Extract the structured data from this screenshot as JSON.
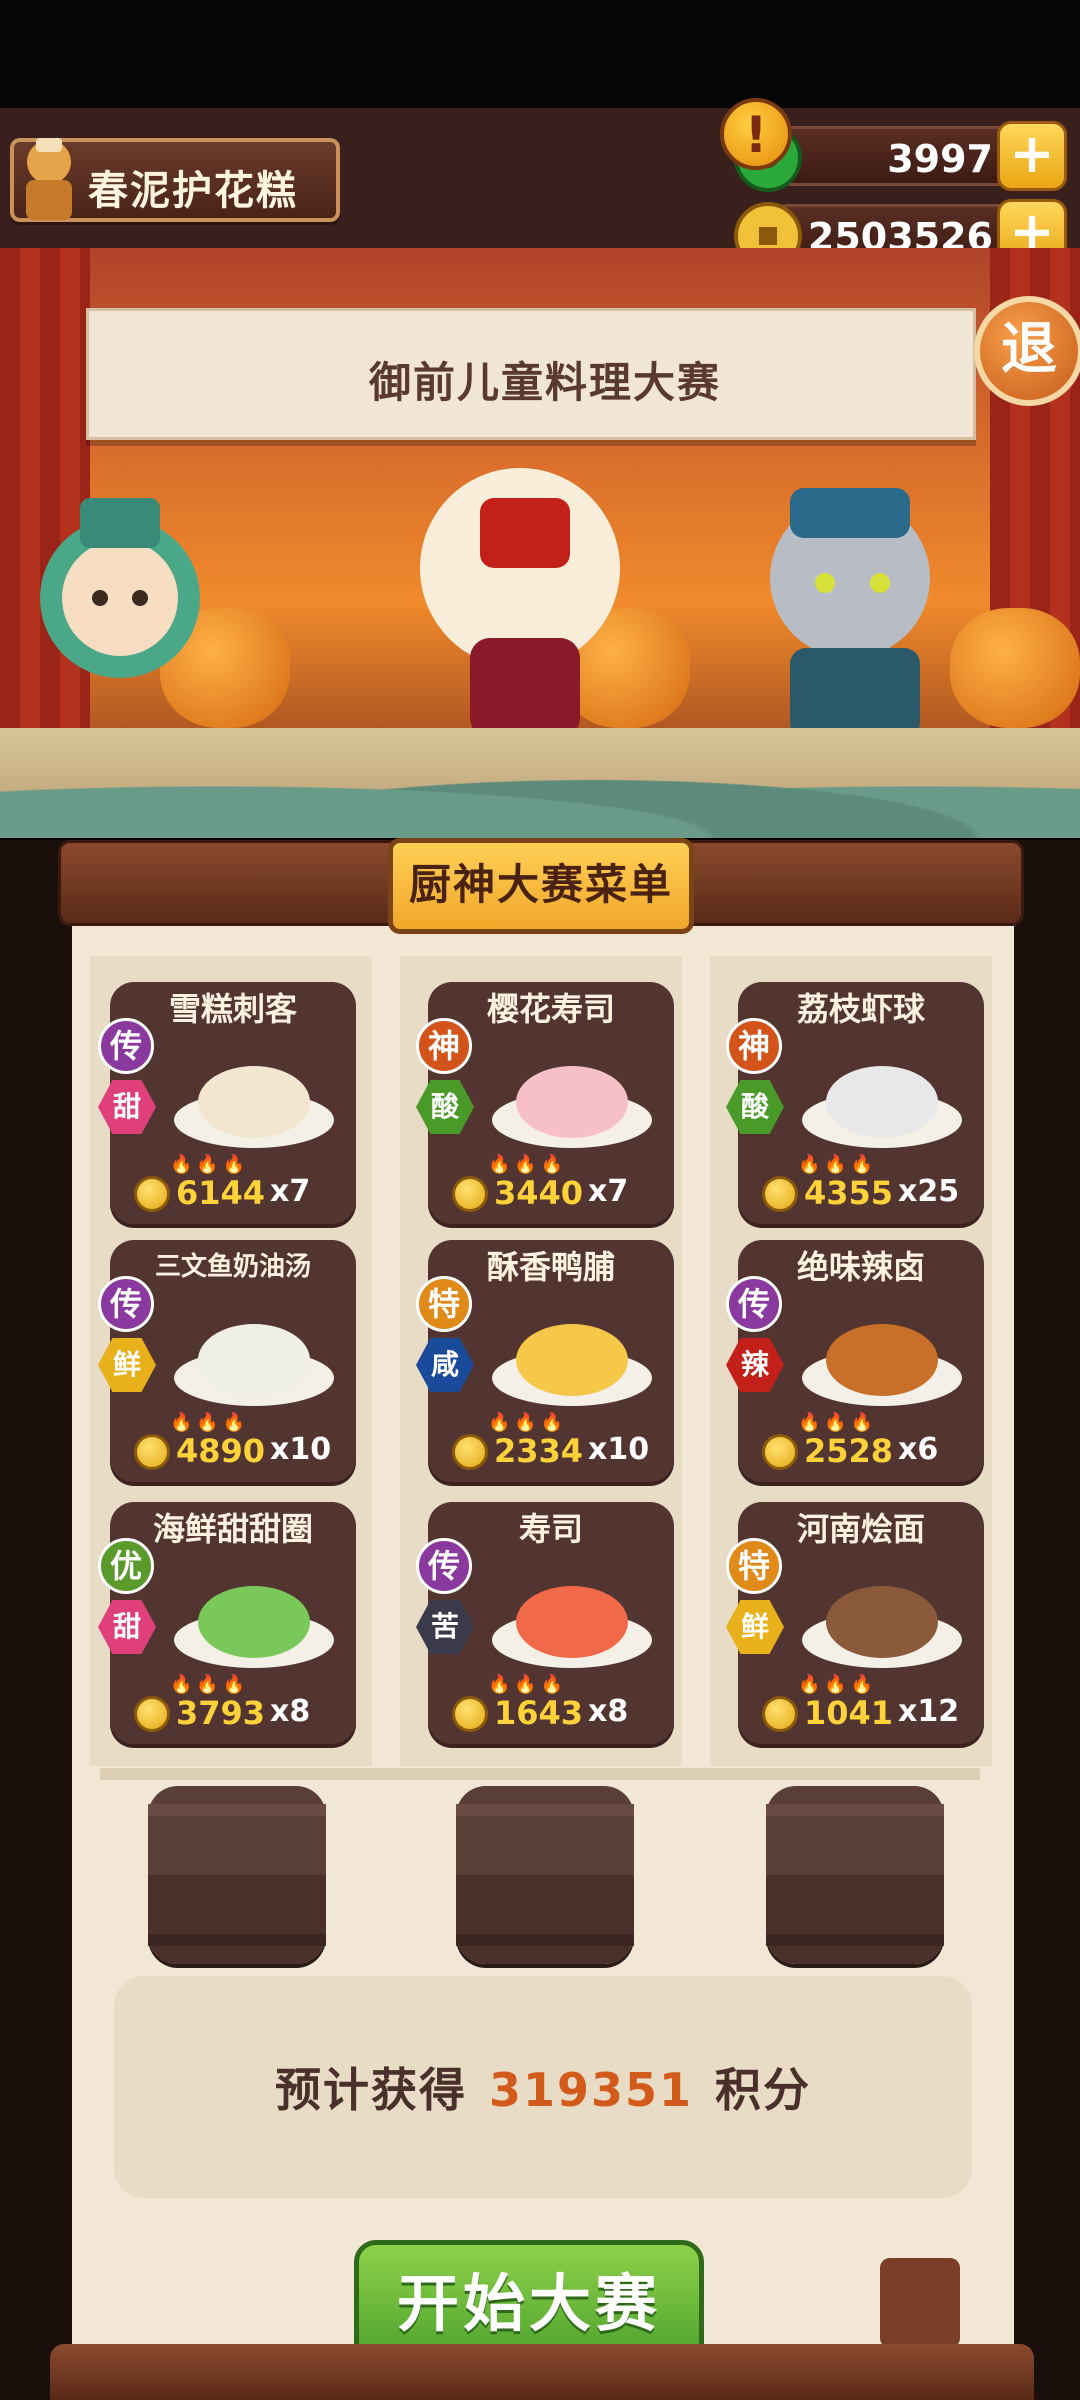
{
  "player": {
    "name": "春泥护花糕"
  },
  "currency": {
    "jade": {
      "value": "3997",
      "icon": "jade-icon"
    },
    "gold": {
      "value": "2503526",
      "icon": "coin-icon"
    },
    "plus_label": "+"
  },
  "stage": {
    "banner_title": "御前儿童料理大赛",
    "alert_glyph": "!",
    "exit_label": "退"
  },
  "menu": {
    "title": "厨神大赛菜单",
    "dishes": [
      {
        "name": "雪糕刺客",
        "rank": "传",
        "taste": "甜",
        "price": "6144",
        "qty": "x7"
      },
      {
        "name": "樱花寿司",
        "rank": "神",
        "taste": "酸",
        "price": "3440",
        "qty": "x7"
      },
      {
        "name": "荔枝虾球",
        "rank": "神",
        "taste": "酸",
        "price": "4355",
        "qty": "x25"
      },
      {
        "name": "三文鱼奶油汤",
        "rank": "传",
        "taste": "鲜",
        "price": "4890",
        "qty": "x10"
      },
      {
        "name": "酥香鸭脯",
        "rank": "特",
        "taste": "咸",
        "price": "2334",
        "qty": "x10"
      },
      {
        "name": "绝味辣卤",
        "rank": "传",
        "taste": "辣",
        "price": "2528",
        "qty": "x6"
      },
      {
        "name": "海鲜甜甜圈",
        "rank": "优",
        "taste": "甜",
        "price": "3793",
        "qty": "x8"
      },
      {
        "name": "寿司",
        "rank": "传",
        "taste": "苦",
        "price": "1643",
        "qty": "x8"
      },
      {
        "name": "河南烩面",
        "rank": "特",
        "taste": "鲜",
        "price": "1041",
        "qty": "x12"
      }
    ]
  },
  "estimate": {
    "prefix": "预计获得",
    "value": "319351",
    "suffix": "积分"
  },
  "start_button": {
    "label": "开始大赛"
  },
  "colors": {
    "rank_传": "#8a3a9e",
    "rank_神": "#d2541a",
    "rank_特": "#e08a1a",
    "rank_优": "#5a9a2a",
    "taste_甜": "#e0407a",
    "taste_酸": "#4a9a2a",
    "taste_鲜": "#e8b01a",
    "taste_咸": "#1a4a9a",
    "taste_辣": "#c4201a",
    "taste_苦": "#3a3a4a"
  }
}
